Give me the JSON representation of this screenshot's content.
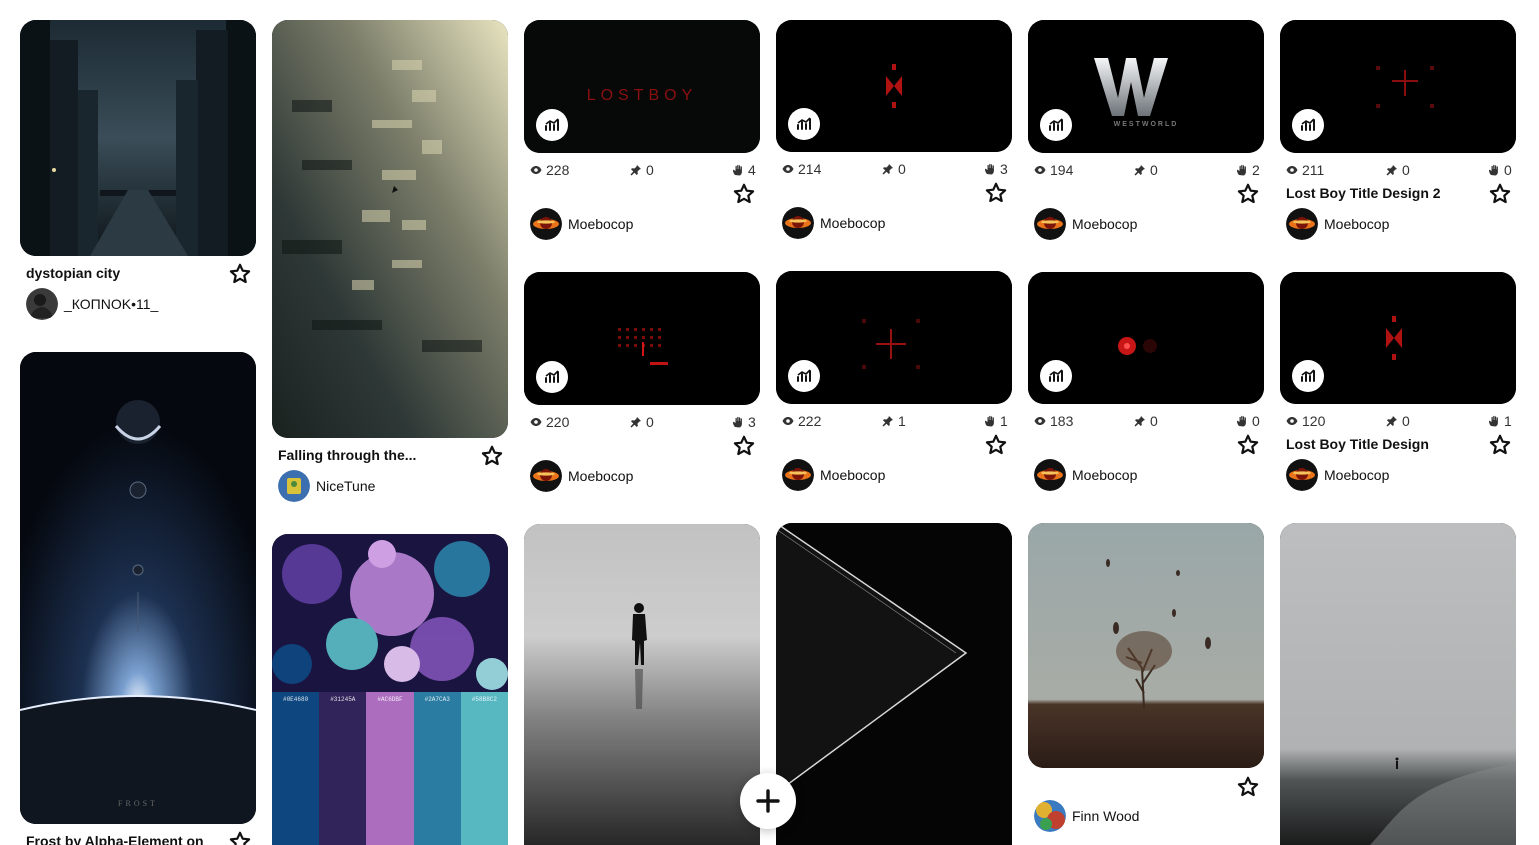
{
  "colors": {
    "stat_icon": "#333333",
    "star": "#111111",
    "fab_bg": "#ffffff"
  },
  "icons": {
    "stats": "chart-icon",
    "views": "eye-icon",
    "pins": "pushpin-icon",
    "saves": "hand-icon",
    "save": "star-outline-icon",
    "add": "plus-icon"
  },
  "pins": {
    "dystopian": {
      "title": "dystopian city",
      "author": "_КОПNOK•11_"
    },
    "falling": {
      "title": "Falling through the...",
      "author": "NiceTune"
    },
    "frost": {
      "title": "Frost by Alpha-Element on"
    },
    "lostboy_wordmark": {
      "thumb_text": "LOSTBOY",
      "views": "228",
      "pins": "0",
      "saves": "4",
      "author": "Moebocop"
    },
    "bowtie_a": {
      "views": "214",
      "pins": "0",
      "saves": "3",
      "author": "Moebocop"
    },
    "westworld": {
      "thumb_text": "WESTWORLD",
      "views": "194",
      "pins": "0",
      "saves": "2",
      "author": "Moebocop"
    },
    "lostboy_2": {
      "views": "211",
      "pins": "0",
      "saves": "0",
      "title": "Lost Boy Title Design 2",
      "author": "Moebocop"
    },
    "grid_red": {
      "views": "220",
      "pins": "0",
      "saves": "3",
      "author": "Moebocop"
    },
    "cross_red": {
      "views": "222",
      "pins": "1",
      "saves": "1",
      "author": "Moebocop"
    },
    "red_dot": {
      "views": "183",
      "pins": "0",
      "saves": "0",
      "author": "Moebocop"
    },
    "lostboy_1": {
      "views": "120",
      "pins": "0",
      "saves": "1",
      "title": "Lost Boy Title Design",
      "author": "Moebocop"
    },
    "palette": {
      "swatches": [
        {
          "hex": "#0E4680",
          "label": "#0E4680"
        },
        {
          "hex": "#31245A",
          "label": "#31245A"
        },
        {
          "hex": "#AC6DBF",
          "label": "#AC6DBF"
        },
        {
          "hex": "#2A7CA3",
          "label": "#2A7CA3"
        },
        {
          "hex": "#58B8C2",
          "label": "#58B8C2"
        }
      ]
    },
    "finn": {
      "author": "Finn Wood"
    }
  }
}
